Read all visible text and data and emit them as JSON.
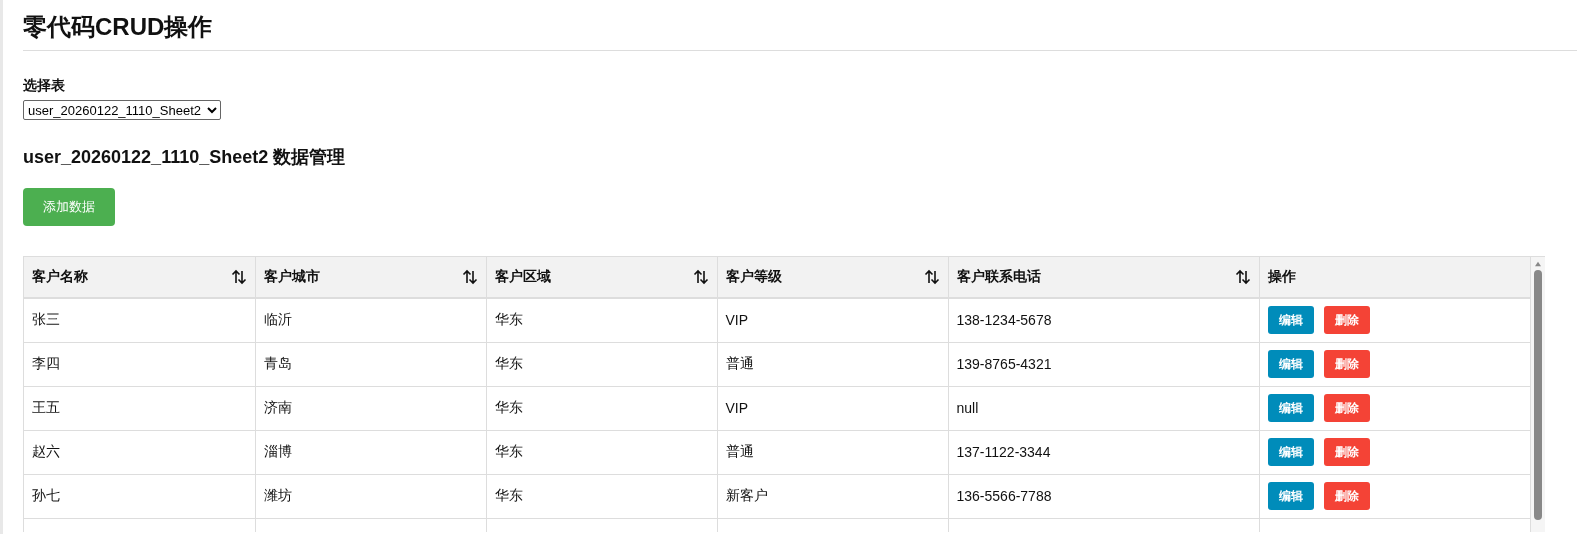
{
  "page": {
    "title": "零代码CRUD操作"
  },
  "table_picker": {
    "label": "选择表",
    "value": "user_20260122_1110_Sheet2"
  },
  "section": {
    "title": "user_20260122_1110_Sheet2 数据管理",
    "add_button": "添加数据"
  },
  "table": {
    "columns": [
      {
        "label": "客户名称",
        "sortable": true
      },
      {
        "label": "客户城市",
        "sortable": true
      },
      {
        "label": "客户区域",
        "sortable": true
      },
      {
        "label": "客户等级",
        "sortable": true
      },
      {
        "label": "客户联系电话",
        "sortable": true
      },
      {
        "label": "操作",
        "sortable": false
      }
    ],
    "rows": [
      {
        "cells": [
          "张三",
          "临沂",
          "华东",
          "VIP",
          "138-1234-5678"
        ],
        "actions": [
          "编辑",
          "删除"
        ]
      },
      {
        "cells": [
          "李四",
          "青岛",
          "华东",
          "普通",
          "139-8765-4321"
        ],
        "actions": [
          "编辑",
          "删除"
        ]
      },
      {
        "cells": [
          "王五",
          "济南",
          "华东",
          "VIP",
          "null"
        ],
        "actions": [
          "编辑",
          "删除"
        ]
      },
      {
        "cells": [
          "赵六",
          "淄博",
          "华东",
          "普通",
          "137-1122-3344"
        ],
        "actions": [
          "编辑",
          "删除"
        ]
      },
      {
        "cells": [
          "孙七",
          "潍坊",
          "华东",
          "新客户",
          "136-5566-7788"
        ],
        "actions": [
          "编辑",
          "删除"
        ]
      }
    ]
  }
}
